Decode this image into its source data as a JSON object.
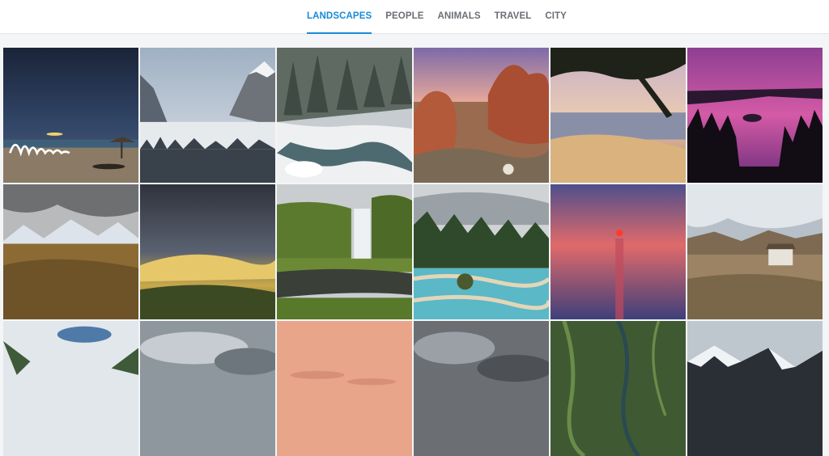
{
  "nav": {
    "tabs": [
      {
        "label": "LANDSCAPES",
        "active": true
      },
      {
        "label": "PEOPLE",
        "active": false
      },
      {
        "label": "ANIMALS",
        "active": false
      },
      {
        "label": "TRAVEL",
        "active": false
      },
      {
        "label": "CITY",
        "active": false
      }
    ],
    "accent_color": "#1a8ad6"
  },
  "gallery": {
    "photos": [
      {
        "subject": "night beach with light painting"
      },
      {
        "subject": "foggy mountain valley"
      },
      {
        "subject": "snowy forest creek"
      },
      {
        "subject": "desert red rocks"
      },
      {
        "subject": "sunset beach under tree"
      },
      {
        "subject": "purple lake at dusk"
      },
      {
        "subject": "mountain grassland under clouds"
      },
      {
        "subject": "stormy sky over green hills"
      },
      {
        "subject": "waterfall in green valley"
      },
      {
        "subject": "turquoise terraced pools"
      },
      {
        "subject": "red sunset over the sea"
      },
      {
        "subject": "rural hillside house"
      },
      {
        "subject": "cloudy sky over green mountains"
      },
      {
        "subject": "gray cloudy sky"
      },
      {
        "subject": "pink hazy sky"
      },
      {
        "subject": "dark storm clouds"
      },
      {
        "subject": "aerial view of rivers"
      },
      {
        "subject": "snowy mountain peak"
      }
    ]
  }
}
